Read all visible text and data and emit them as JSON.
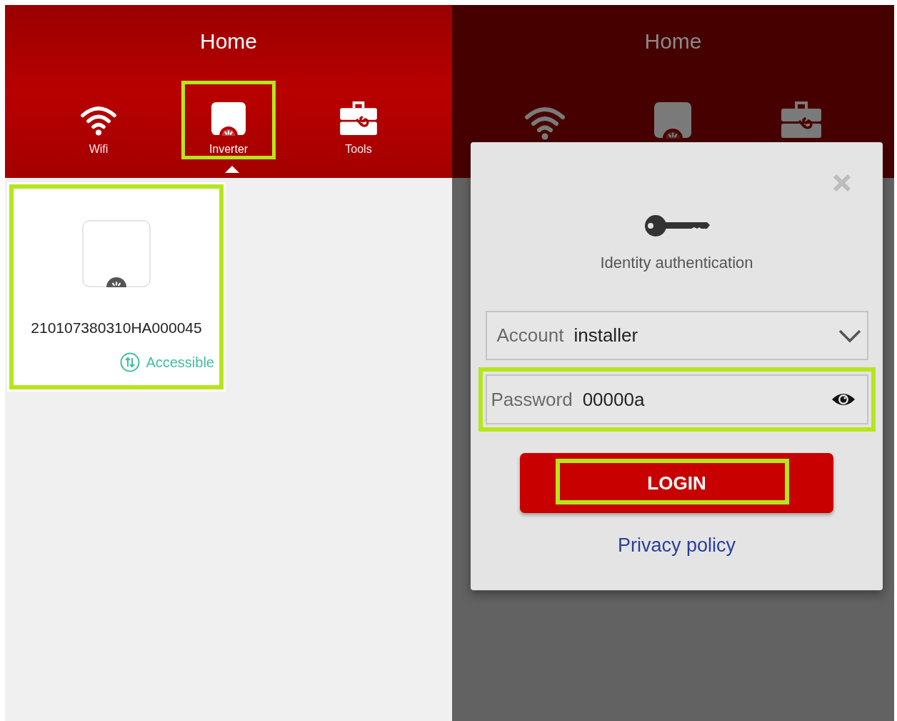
{
  "home_screen": {
    "title": "Home",
    "tabs": [
      {
        "kind": "wifi",
        "label": "Wifi",
        "selected": false,
        "highlighted": false
      },
      {
        "kind": "inverter",
        "label": "Inverter",
        "selected": true,
        "highlighted": true
      },
      {
        "kind": "tools",
        "label": "Tools",
        "selected": false,
        "highlighted": false
      }
    ],
    "devices": [
      {
        "serial": "210107380310HA000045",
        "status": "Accessible",
        "highlighted": true
      }
    ]
  },
  "background_screen": {
    "title": "Home",
    "tabs": [
      {
        "kind": "wifi"
      },
      {
        "kind": "inverter"
      },
      {
        "kind": "tools"
      }
    ]
  },
  "login_dialog": {
    "title": "Identity authentication",
    "fields": [
      {
        "kind": "select",
        "label": "Account",
        "value": "installer",
        "highlighted": false
      },
      {
        "kind": "password",
        "label": "Password",
        "value": "00000a",
        "highlighted": true
      }
    ],
    "login_button": {
      "label": "LOGIN",
      "highlighted": true
    },
    "link": "Privacy policy"
  }
}
